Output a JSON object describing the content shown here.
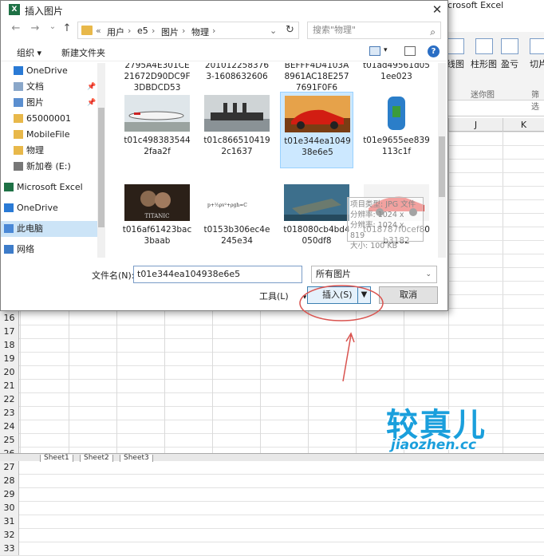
{
  "excel": {
    "title_fragment": "icrosoft Excel",
    "ribbon": {
      "buttons": [
        "线图",
        "柱形图",
        "盈亏",
        "切片"
      ],
      "groups": [
        "迷你图",
        "筛选"
      ]
    },
    "columns": [
      "J",
      "K"
    ],
    "rows": [
      "16",
      "17",
      "18",
      "19",
      "20",
      "21",
      "22",
      "23",
      "24",
      "25",
      "26",
      "27",
      "28",
      "29",
      "30",
      "31",
      "32",
      "33"
    ],
    "sheet_tabs": [
      "Sheet1",
      "Sheet2",
      "Sheet3"
    ]
  },
  "dialog": {
    "title": "插入图片",
    "close": "✕",
    "nav": {
      "back": "←",
      "forward": "→",
      "dropdown": "⌄",
      "up": "↑"
    },
    "address": [
      "«",
      "用户",
      "›",
      "e5",
      "›",
      "图片",
      "›",
      "物理",
      "›"
    ],
    "address_dropdown": "⌄",
    "refresh": "↻",
    "search_placeholder": "搜索\"物理\"",
    "search_icon": "⌕",
    "toolbar": {
      "organize": "组织 ▾",
      "new_folder": "新建文件夹",
      "help": "?"
    },
    "nav_items": [
      {
        "label": "OneDrive",
        "icon": "onedrive-icon",
        "pin": ""
      },
      {
        "label": "文档",
        "icon": "document-icon",
        "pin": "📌"
      },
      {
        "label": "图片",
        "icon": "picture-icon",
        "pin": "📌"
      },
      {
        "label": "65000001",
        "icon": "folder-icon",
        "pin": ""
      },
      {
        "label": "MobileFile",
        "icon": "folder-icon",
        "pin": ""
      },
      {
        "label": "物理",
        "icon": "folder-icon",
        "pin": ""
      },
      {
        "label": "新加卷 (E:)",
        "icon": "drive-icon",
        "pin": ""
      },
      {
        "label": "Microsoft Excel",
        "icon": "excel-icon",
        "pin": ""
      },
      {
        "label": "OneDrive",
        "icon": "onedrive-icon",
        "pin": ""
      },
      {
        "label": "此电脑",
        "icon": "computer-icon",
        "pin": ""
      },
      {
        "label": "网络",
        "icon": "network-icon",
        "pin": ""
      }
    ],
    "files_top_row": [
      "21672D90DC9F\n3DBDCD53",
      "3-1608632606",
      "8961AC18E257\n7691F0F6",
      "1ee023"
    ],
    "files_top_row_cut": [
      "2795A4E301CE",
      "201012258376",
      "BEFFF4D4103A",
      "t01ad49561d05"
    ],
    "files": [
      {
        "name": "t01c498383544\n2faa2f",
        "thumb": "airplane"
      },
      {
        "name": "t01c866510419\n2c1637",
        "thumb": "ship"
      },
      {
        "name": "t01e344ea1049\n38e6e5",
        "thumb": "sportscar",
        "selected": true
      },
      {
        "name": "t01e9655ee839\n113c1f",
        "thumb": "water-jug"
      },
      {
        "name": "t016af61423bac\n3baab",
        "thumb": "titanic-poster"
      },
      {
        "name": "t0153b306ec4e\n245e34",
        "thumb": "formula"
      },
      {
        "name": "t018080cb4bd4\n050df8",
        "thumb": "shipwreck"
      },
      {
        "name": "t018787f0cef80\nb3182",
        "thumb": "redcar"
      }
    ],
    "tooltip": [
      "项目类型: JPG 文件",
      "分辨率: 1024 x",
      "分辨率: 1024 x 819",
      "大小: 100 KB"
    ],
    "filename_label": "文件名(N):",
    "filename_value": "t01e344ea104938e6e5",
    "filetype_value": "所有图片",
    "filetype_arrow": "⌄",
    "tools_label": "工具(L)",
    "tools_arrow": "▾",
    "insert_label": "插入(S)",
    "insert_arrow": "▼",
    "cancel_label": "取消"
  },
  "watermark": {
    "big": "较真儿",
    "small": "jiaozhen.cc"
  },
  "colors": {
    "selection": "#cce8ff",
    "accent": "#1a9fdc",
    "annotation": "#d9534f"
  }
}
